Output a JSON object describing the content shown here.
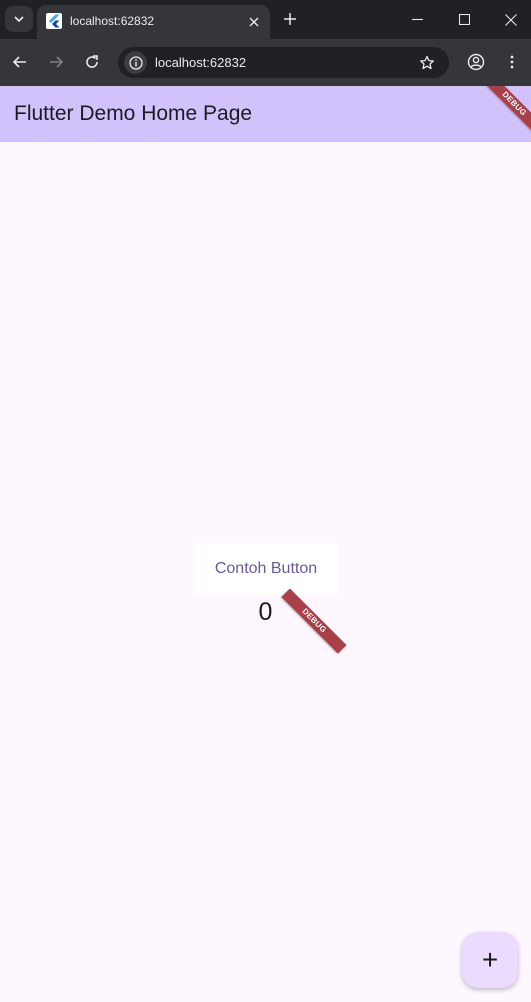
{
  "browser": {
    "tab_title": "localhost:62832",
    "url": "localhost:62832"
  },
  "app": {
    "appbar_title": "Flutter Demo Home Page",
    "debug_banner_label": "DEBUG",
    "content_button_label": "Contoh Button",
    "counter_value": "0",
    "fab_label": "+",
    "colors": {
      "appbar": "#d1c2fb",
      "background": "#fef7ff",
      "debug_banner": "#a93f47",
      "fab": "#ebdcff",
      "button_text": "#6b5a98"
    }
  }
}
